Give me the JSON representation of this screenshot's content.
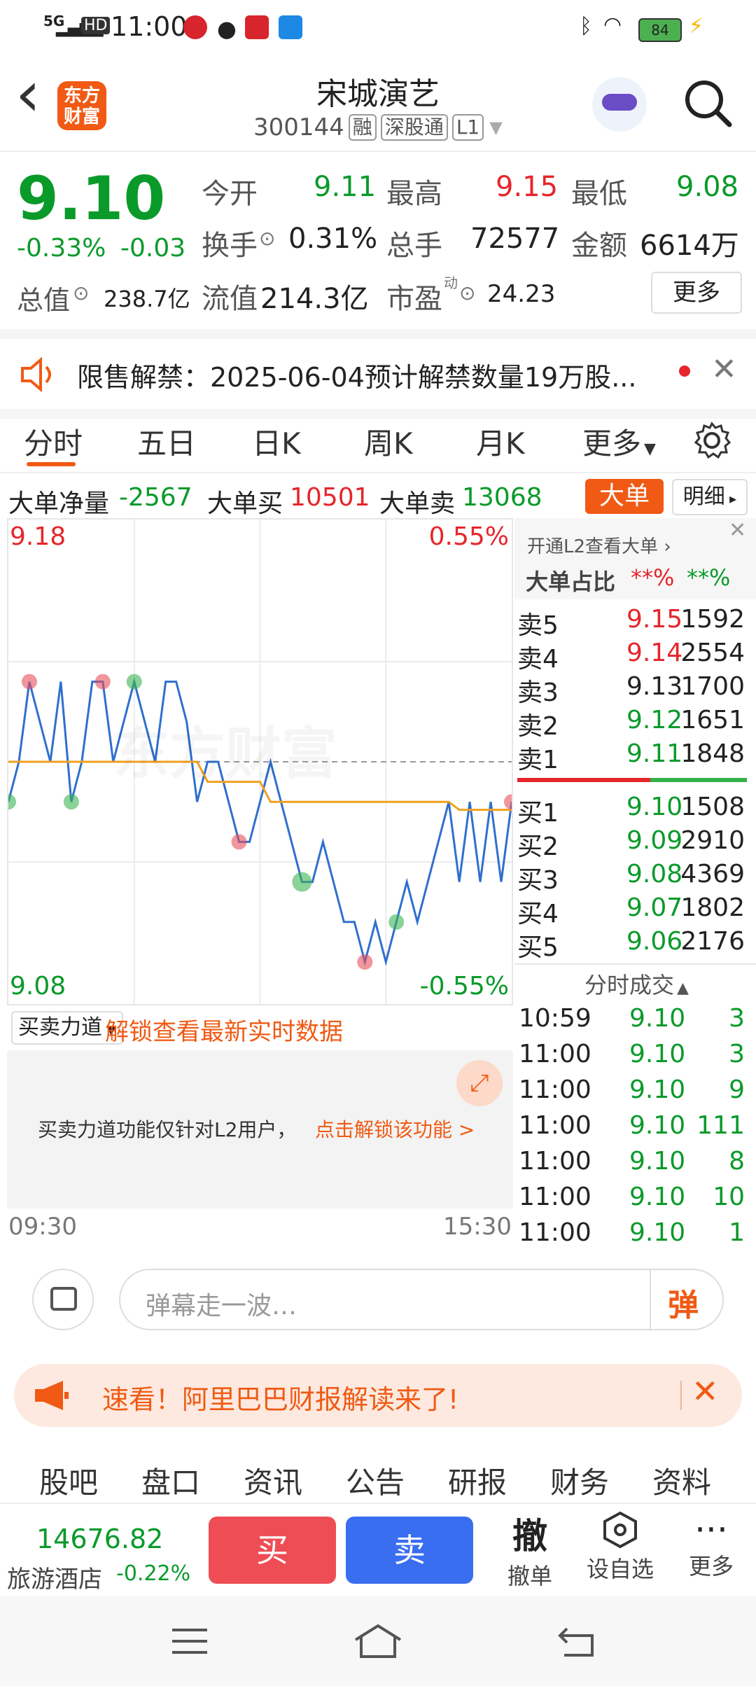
{
  "status_bar": {
    "network": "5G",
    "hd": "HD",
    "time": "11:00",
    "battery": "84"
  },
  "header": {
    "back": "‹",
    "logo_line1": "东方",
    "logo_line2": "财富",
    "title": "宋城演艺",
    "code": "300144",
    "tags": [
      "融",
      "深股通",
      "L1"
    ]
  },
  "quote": {
    "price": "9.10",
    "change_pct": "-0.33%",
    "change": "-0.03",
    "open_label": "今开",
    "open": "9.11",
    "high_label": "最高",
    "high": "9.15",
    "low_label": "最低",
    "low": "9.08",
    "turnover_label": "换手",
    "turnover": "0.31%",
    "volume_label": "总手",
    "volume": "72577",
    "amount_label": "金额",
    "amount": "6614万",
    "mktcap_label": "总值",
    "mktcap": "238.7亿",
    "float_label": "流值",
    "float": "214.3亿",
    "pe_label": "市盈",
    "pe_sup": "动",
    "pe": "24.23",
    "more": "更多"
  },
  "notice": {
    "text": "限售解禁：2025-06-04预计解禁数量19万股..."
  },
  "tabs": [
    "分时",
    "五日",
    "日K",
    "周K",
    "月K",
    "更多",
    ""
  ],
  "big_order": {
    "net_label": "大单净量",
    "net": "-2567",
    "buy_label": "大单买",
    "buy": "10501",
    "sell_label": "大单卖",
    "sell": "13068",
    "btn_big": "大单",
    "btn_detail": "明细"
  },
  "chart": {
    "y_top": "9.18",
    "y_bottom": "9.08",
    "pct_top": "0.55%",
    "pct_bottom": "-0.55%",
    "x_start": "09:30",
    "x_end": "15:30",
    "watermark": "东方财富"
  },
  "chart_data": {
    "type": "line",
    "ylim": [
      9.08,
      9.18
    ],
    "prev_close": 9.13,
    "series": [
      {
        "values": [
          9.12,
          9.13,
          9.15,
          9.14,
          9.13,
          9.15,
          9.12,
          9.13,
          9.15,
          9.15,
          9.13,
          9.14,
          9.15,
          9.14,
          9.13,
          9.15,
          9.15,
          9.14,
          9.12,
          9.13,
          9.13,
          9.12,
          9.11,
          9.11,
          9.12,
          9.13,
          9.12,
          9.11,
          9.1,
          9.1,
          9.11,
          9.1,
          9.09,
          9.09,
          9.08,
          9.09,
          9.08,
          9.09,
          9.1,
          9.09,
          9.1,
          9.11,
          9.12,
          9.1,
          9.12,
          9.1,
          9.12,
          9.1,
          9.12,
          9.11
        ]
      },
      {
        "values": [
          9.13,
          9.13,
          9.13,
          9.13,
          9.13,
          9.13,
          9.13,
          9.13,
          9.13,
          9.13,
          9.13,
          9.13,
          9.13,
          9.13,
          9.13,
          9.13,
          9.13,
          9.13,
          9.13,
          9.125,
          9.125,
          9.125,
          9.125,
          9.125,
          9.125,
          9.12,
          9.12,
          9.12,
          9.12,
          9.12,
          9.12,
          9.12,
          9.12,
          9.12,
          9.12,
          9.12,
          9.12,
          9.12,
          9.12,
          9.12,
          9.12,
          9.12,
          9.12,
          9.118,
          9.118,
          9.118,
          9.118,
          9.118,
          9.118,
          9.118
        ]
      }
    ]
  },
  "panel": {
    "l2_link": "开通L2查看大单 ›",
    "ratio_label": "大单占比",
    "ratio_buy": "**%",
    "ratio_sell": "**%",
    "asks": [
      {
        "label": "卖5",
        "price": "9.15",
        "vol": "1592",
        "color": "red"
      },
      {
        "label": "卖4",
        "price": "9.14",
        "vol": "2554",
        "color": "red"
      },
      {
        "label": "卖3",
        "price": "9.13",
        "vol": "1700",
        "color": "black"
      },
      {
        "label": "卖2",
        "price": "9.12",
        "vol": "1651",
        "color": "green"
      },
      {
        "label": "卖1",
        "price": "9.11",
        "vol": "1848",
        "color": "green"
      }
    ],
    "bids": [
      {
        "label": "买1",
        "price": "9.10",
        "vol": "1508"
      },
      {
        "label": "买2",
        "price": "9.09",
        "vol": "2910"
      },
      {
        "label": "买3",
        "price": "9.08",
        "vol": "4369"
      },
      {
        "label": "买4",
        "price": "9.07",
        "vol": "1802"
      },
      {
        "label": "买5",
        "price": "9.06",
        "vol": "2176"
      }
    ],
    "ticks_title": "分时成交",
    "ticks": [
      {
        "time": "10:59",
        "price": "9.10",
        "vol": "3"
      },
      {
        "time": "11:00",
        "price": "9.10",
        "vol": "3"
      },
      {
        "time": "11:00",
        "price": "9.10",
        "vol": "9"
      },
      {
        "time": "11:00",
        "price": "9.10",
        "vol": "111"
      },
      {
        "time": "11:00",
        "price": "9.10",
        "vol": "8"
      },
      {
        "time": "11:00",
        "price": "9.10",
        "vol": "10"
      },
      {
        "time": "11:00",
        "price": "9.10",
        "vol": "1"
      }
    ]
  },
  "force": {
    "select": "买卖力道",
    "unlock": "解锁查看最新实时数据",
    "locked_text": "买卖力道功能仅针对L2用户，",
    "locked_link": "点击解锁该功能 >"
  },
  "danmu": {
    "placeholder": "弹幕走一波…",
    "btn": "弹"
  },
  "promo": {
    "text": "速看！阿里巴巴财报解读来了!"
  },
  "bottom_tabs": [
    "股吧",
    "盘口",
    "资讯",
    "公告",
    "研报",
    "财务",
    "资料"
  ],
  "trade": {
    "index_value": "14676.82",
    "index_name": "旅游酒店",
    "index_change": "-0.22%",
    "buy": "买",
    "sell": "卖",
    "cancel_icon": "撤",
    "cancel": "撤单",
    "watch": "设自选",
    "more": "更多"
  }
}
